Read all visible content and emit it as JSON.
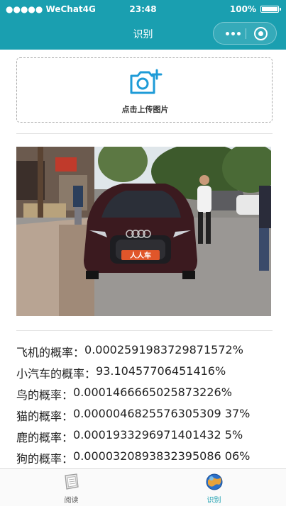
{
  "status_bar": {
    "carrier": "●●●●● WeChat4G",
    "time": "23:48",
    "battery": "100%"
  },
  "nav": {
    "title": "识别"
  },
  "upload": {
    "label": "点击上传图片",
    "icon": "camera-add-icon"
  },
  "photo": {
    "description_icon": "uploaded-photo",
    "plate_text": "人人车"
  },
  "results": [
    {
      "label": "飞机的概率：",
      "value": "0.00025919837298715​72%"
    },
    {
      "label": "小汽车的概率：",
      "value": "93.10457706451416%"
    },
    {
      "label": "鸟的概率：",
      "value": "0.0001466665025873226%"
    },
    {
      "label": "猫的概率：",
      "value": "0.0000046825576305309 37%"
    },
    {
      "label": "鹿的概率：",
      "value": "0.0001933296971401432 5%"
    },
    {
      "label": "狗的概率：",
      "value": "0.0000320893832395086 06%"
    }
  ],
  "tabbar": {
    "tabs": [
      {
        "label": "阅读",
        "icon": "reading-icon",
        "active": false
      },
      {
        "label": "识别",
        "icon": "recognize-icon",
        "active": true
      }
    ]
  },
  "colors": {
    "brand": "#1a9fb0",
    "accent_icon": "#1e9bd7"
  }
}
